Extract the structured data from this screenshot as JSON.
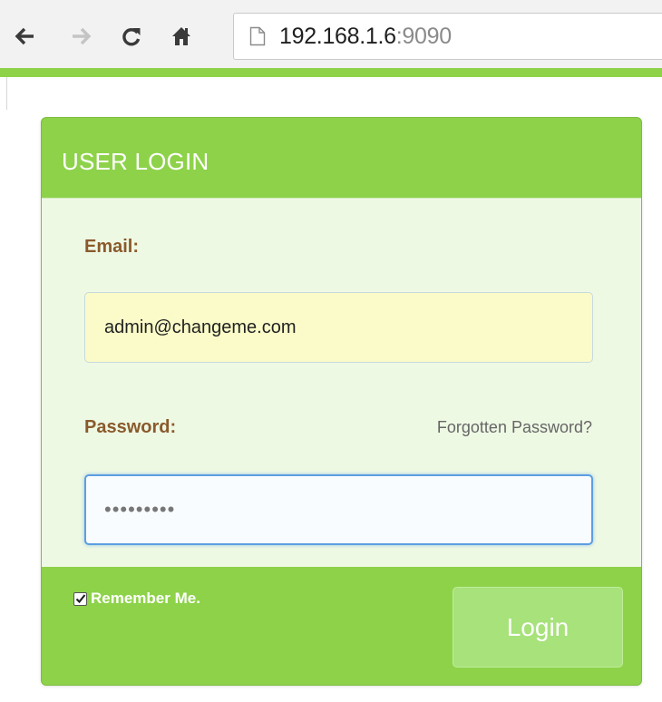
{
  "browser": {
    "url_host": "192.168.1.6",
    "url_port": ":9090",
    "icons": [
      "back-arrow-icon",
      "forward-arrow-icon",
      "reload-icon",
      "home-icon",
      "page-icon"
    ]
  },
  "login": {
    "title": "USER LOGIN",
    "email_label": "Email:",
    "email_value": "admin@changeme.com",
    "password_label": "Password:",
    "forgot_label": "Forgotten Password?",
    "password_value": "•••••••••",
    "remember_label": "Remember Me.",
    "remember_checked": true,
    "login_label": "Login"
  },
  "colors": {
    "accent_green": "#8ed24a",
    "panel_body": "#eef9e4",
    "label_brown": "#8a5a2c",
    "email_fill": "#fafbc8",
    "focus_blue": "#5d9ee0",
    "button_green": "#a7e27a"
  }
}
